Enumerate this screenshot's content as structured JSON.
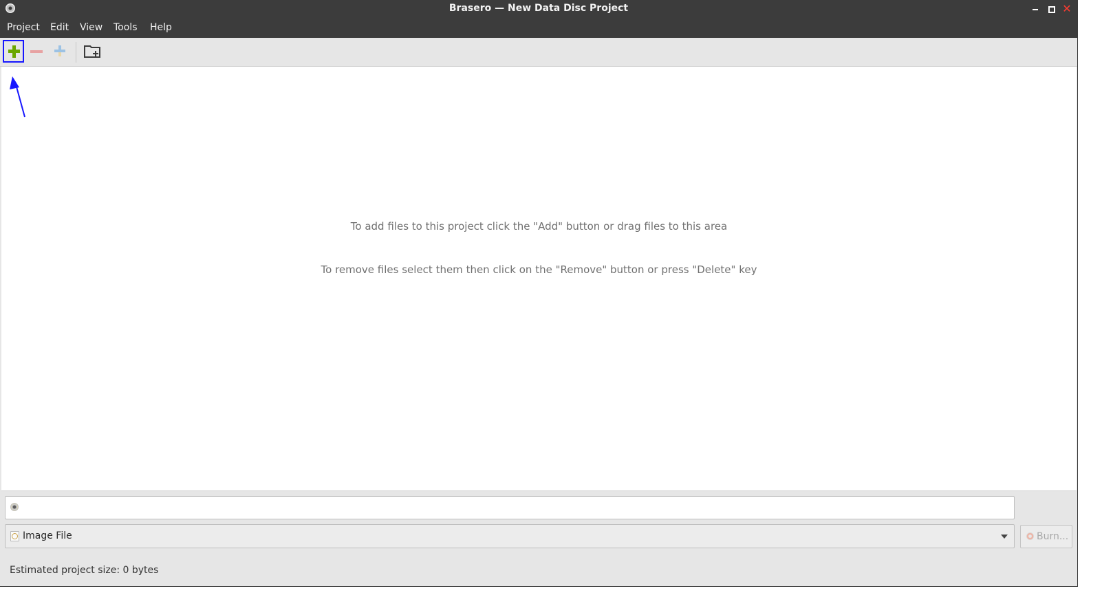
{
  "window": {
    "title": "Brasero — New Data Disc Project",
    "close_glyph": "✕"
  },
  "menu": {
    "items": [
      "Project",
      "Edit",
      "View",
      "Tools",
      "Help"
    ]
  },
  "toolbar": {
    "buttons": [
      "add-icon",
      "remove-icon",
      "split-icon",
      "new-folder-icon"
    ]
  },
  "main": {
    "hint_add": "To add files to this project click the \"Add\" button or drag files to this area",
    "hint_remove": "To remove files select them then click on the \"Remove\" button or press \"Delete\" key"
  },
  "bottom": {
    "disc_selector_value": "Image File",
    "burn_label": "Burn...",
    "status": "Estimated project size: 0 bytes"
  },
  "colors": {
    "titlebar": "#3c3c3c",
    "highlight": "#1616ff",
    "add_green": "#6aa600"
  }
}
